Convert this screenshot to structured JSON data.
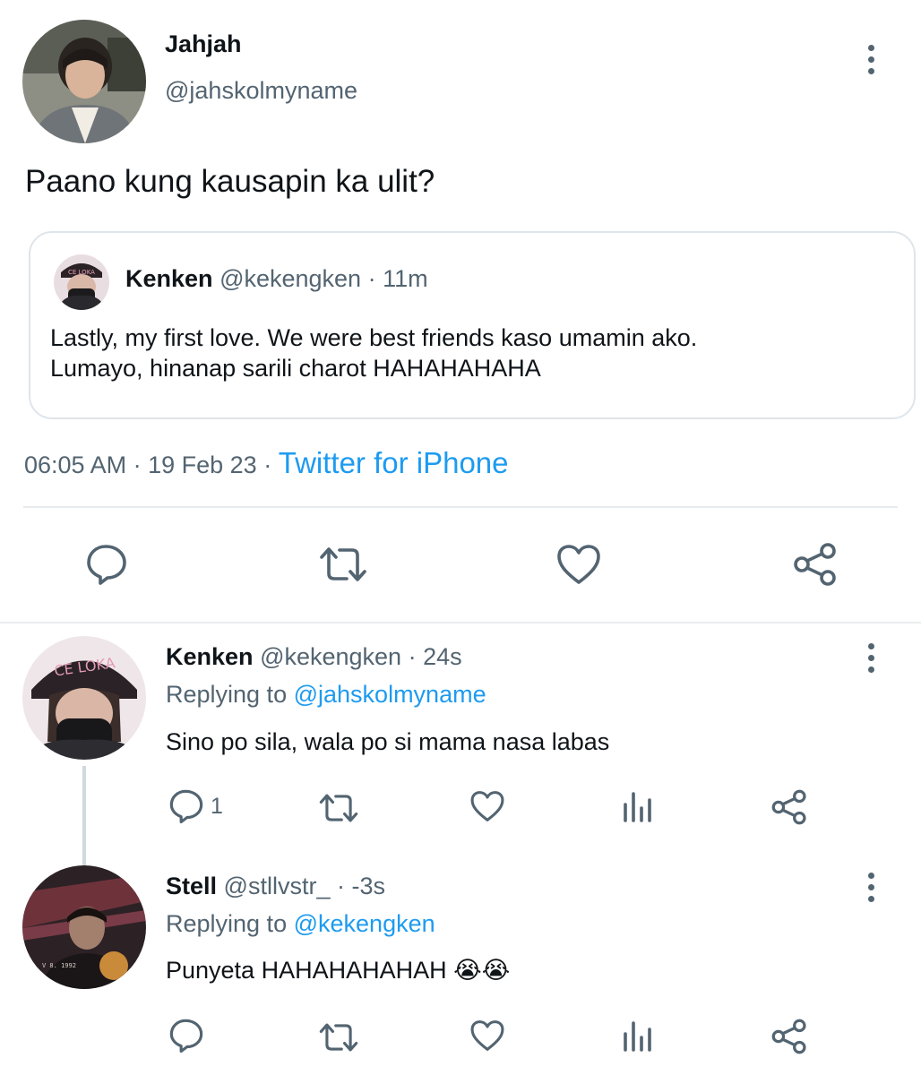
{
  "tweet": {
    "author_name": "Jahjah",
    "author_handle": "@jahskolmyname",
    "text": "Paano kung kausapin ka ulit?",
    "time": "06:05 AM",
    "date": "19 Feb 23",
    "dot": "·",
    "source": "Twitter for iPhone"
  },
  "quoted": {
    "name": "Kenken",
    "handle": "@kekengken",
    "dot": "·",
    "time": "11m",
    "text_line1": "Lastly, my first love. We were best friends kaso umamin ako.",
    "text_line2": "Lumayo, hinanap sarili charot HAHAHAHAHA"
  },
  "replies": [
    {
      "name": "Kenken",
      "handle": "@kekengken",
      "dot": "·",
      "time": "24s",
      "replying_label": "Replying to",
      "replying_to": "@jahskolmyname",
      "text": "Sino po sila, wala po si mama nasa labas",
      "reply_count": "1"
    },
    {
      "name": "Stell",
      "handle": "@stllvstr_",
      "dot": "·",
      "time": "-3s",
      "replying_label": "Replying to",
      "replying_to": "@kekengken",
      "text": "Punyeta HAHAHAHAHAH",
      "emoji": "😭😭"
    }
  ],
  "icons": [
    "more-vertical-icon",
    "reply-icon",
    "retweet-icon",
    "like-icon",
    "share-icon",
    "analytics-icon"
  ],
  "colors": {
    "link": "#1d9bf0",
    "muted": "#536471",
    "icon": "#536471",
    "text": "#0f1419",
    "thread_line": "#cfd9de"
  }
}
